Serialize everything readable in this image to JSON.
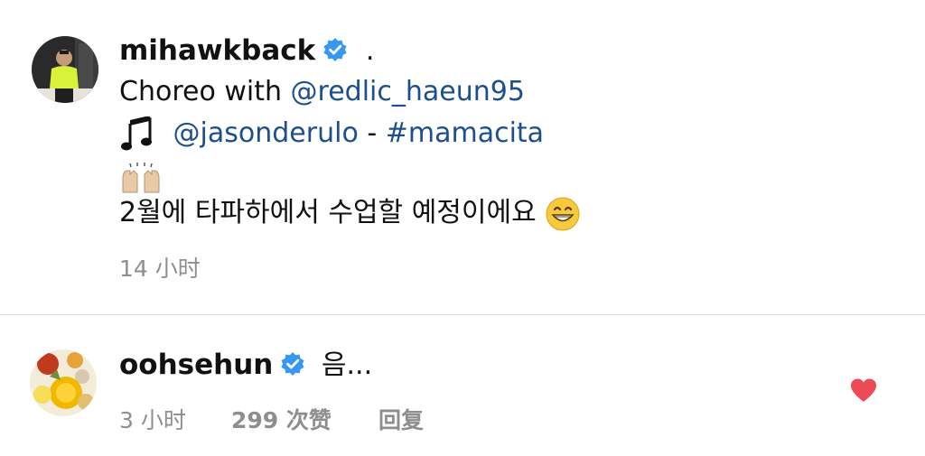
{
  "post": {
    "username": "mihawkback",
    "username_suffix": ".",
    "line1_prefix": "Choreo with",
    "line1_mention": "@redlic_haeun95",
    "line2_mention": "@jasonderulo",
    "line2_separator": "-",
    "line2_hashtag": "#mamacita",
    "line4_text": "2월에 타파하에서 수업할 예정이에요",
    "time": "14 小时",
    "icons": {
      "verified": "verified-badge-icon",
      "music": "music-note-emoji",
      "clap": "raised-hands-emoji",
      "grin": "grinning-face-emoji"
    }
  },
  "comment": {
    "username": "oohsehun",
    "text": "음...",
    "time": "3 小时",
    "likes": "299 次赞",
    "reply": "回复",
    "icons": {
      "verified": "verified-badge-icon",
      "like": "heart-icon"
    }
  },
  "colors": {
    "link": "#1c4f8d",
    "verified": "#3897f0",
    "heart": "#ed4956",
    "meta": "#8e8e8e"
  }
}
